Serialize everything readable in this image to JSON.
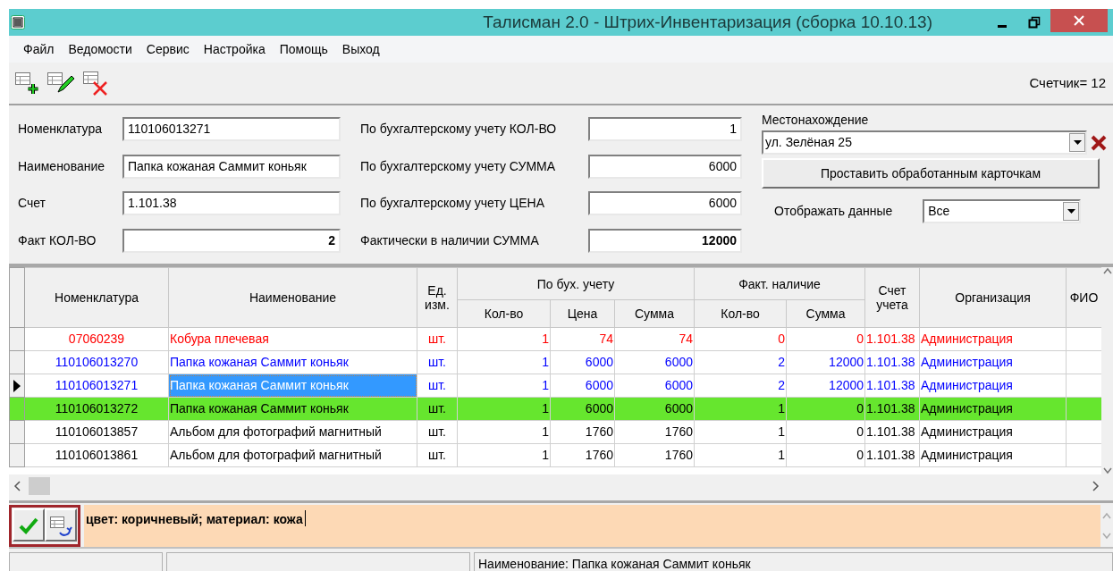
{
  "window": {
    "title": "Талисман 2.0 - Штрих-Инвентаризация (сборка 10.10.13)"
  },
  "menu": [
    "Файл",
    "Ведомости",
    "Сервис",
    "Настройка",
    "Помощь",
    "Выход"
  ],
  "toolbar": {
    "counter": "Счетчик= 12"
  },
  "form": {
    "left_fields": [
      {
        "label": "Номенклатура",
        "value": "110106013271",
        "right_aligned": false,
        "bold": false
      },
      {
        "label": "Наименование",
        "value": "Папка кожаная Саммит коньяк",
        "right_aligned": false,
        "bold": false
      },
      {
        "label": "Счет",
        "value": "1.101.38",
        "right_aligned": false,
        "bold": false
      },
      {
        "label": "Факт КОЛ-ВО",
        "value": "2",
        "right_aligned": true,
        "bold": true
      }
    ],
    "middle_fields": [
      {
        "label": "По бухгалтерскому учету КОЛ-ВО",
        "value": "1",
        "right_aligned": true,
        "bold": false
      },
      {
        "label": "По бухгалтерскому учету СУММА",
        "value": "6000",
        "right_aligned": true,
        "bold": false
      },
      {
        "label": "По бухгалтерскому учету ЦЕНА",
        "value": "6000",
        "right_aligned": true,
        "bold": false
      },
      {
        "label": "Фактически в наличии СУММА",
        "value": "12000",
        "right_aligned": true,
        "bold": true
      }
    ],
    "location": {
      "label": "Местонахождение",
      "value": "ул. Зелёная 25"
    },
    "apply_button": "Проставить обработанным карточкам",
    "display": {
      "label": "Отображать данные",
      "value": "Все"
    }
  },
  "table": {
    "columns": [
      {
        "label": "Номенклатура"
      },
      {
        "label": "Наименование"
      },
      {
        "label": "Ед. изм."
      },
      {
        "group": "По бух. учету",
        "colspan": 3,
        "children": [
          "Кол-во",
          "Цена",
          "Сумма"
        ]
      },
      {
        "group": "Факт. наличие",
        "colspan": 2,
        "children": [
          "Кол-во",
          "Сумма"
        ]
      },
      {
        "label": "Счет учета"
      },
      {
        "label": "Организация"
      },
      {
        "label": "ФИО"
      }
    ],
    "rows": [
      {
        "cells": [
          "07060239",
          "Кобура плечевая",
          "шт.",
          "1",
          "74",
          "74",
          "0",
          "0",
          "1.101.38",
          "Администрация"
        ],
        "color": "#ff0000",
        "marked": false,
        "selected": false
      },
      {
        "cells": [
          "110106013270",
          "Папка кожаная Саммит коньяк",
          "шт.",
          "1",
          "6000",
          "6000",
          "2",
          "12000",
          "1.101.38",
          "Администрация"
        ],
        "color": "#0000ff",
        "marked": false,
        "selected": false
      },
      {
        "cells": [
          "110106013271",
          "Папка кожаная Саммит коньяк",
          "шт.",
          "1",
          "6000",
          "6000",
          "2",
          "12000",
          "1.101.38",
          "Администрация"
        ],
        "color": "#0000ff",
        "marked": false,
        "selected": true
      },
      {
        "cells": [
          "110106013272",
          "Папка кожаная Саммит коньяк",
          "шт.",
          "1",
          "6000",
          "6000",
          "1",
          "0",
          "1.101.38",
          "Администрация"
        ],
        "color": "#000000",
        "marked": true,
        "selected": false
      },
      {
        "cells": [
          "110106013857",
          "Альбом для фотографий магнитный",
          "шт.",
          "1",
          "1760",
          "1760",
          "1",
          "0",
          "1.101.38",
          "Администрация"
        ],
        "color": "#000000",
        "marked": false,
        "selected": false
      },
      {
        "cells": [
          "110106013861",
          "Альбом для фотографий магнитный",
          "шт.",
          "1",
          "1760",
          "1760",
          "1",
          "0",
          "1.101.38",
          "Администрация"
        ],
        "color": "#000000",
        "marked": false,
        "selected": false
      }
    ]
  },
  "memo": {
    "value": "цвет: коричневый; материал: кожа"
  },
  "status_bar": {
    "text": "Наименование: Папка кожаная Саммит коньяк"
  }
}
